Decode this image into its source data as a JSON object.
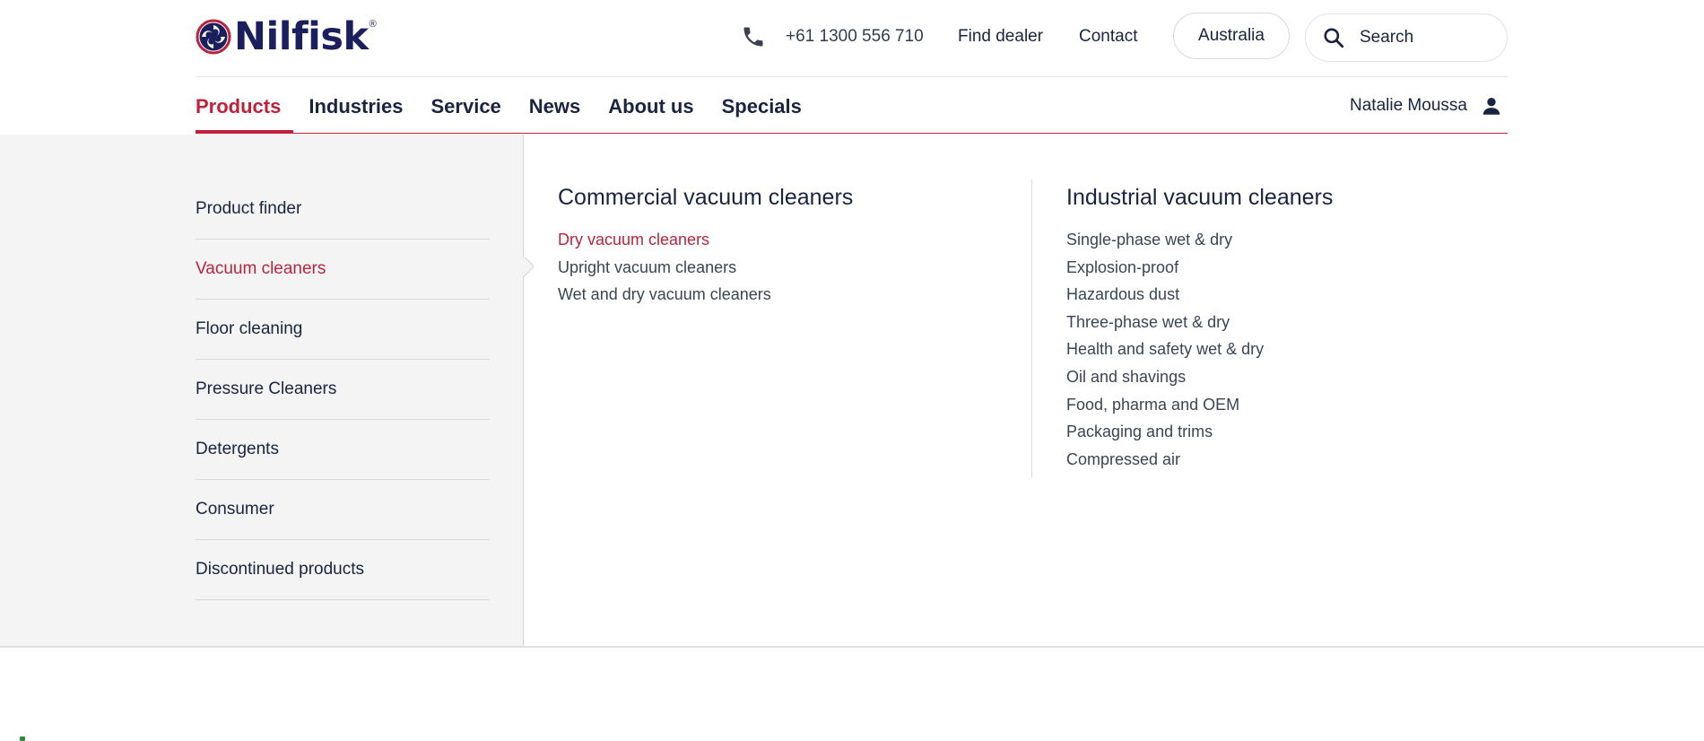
{
  "header": {
    "brand": "Nilfisk",
    "brand_mark": "®",
    "phone": "+61 1300 556 710",
    "find_dealer": "Find dealer",
    "contact": "Contact",
    "country": "Australia",
    "search_placeholder": "Search"
  },
  "nav": {
    "items": [
      {
        "label": "Products",
        "active": true
      },
      {
        "label": "Industries"
      },
      {
        "label": "Service"
      },
      {
        "label": "News"
      },
      {
        "label": "About us"
      },
      {
        "label": "Specials"
      }
    ],
    "user_name": "Natalie Moussa"
  },
  "mega": {
    "categories": [
      {
        "label": "Product finder"
      },
      {
        "label": "Vacuum cleaners",
        "active": true
      },
      {
        "label": "Floor cleaning"
      },
      {
        "label": "Pressure Cleaners"
      },
      {
        "label": "Detergents"
      },
      {
        "label": "Consumer"
      },
      {
        "label": "Discontinued products"
      }
    ],
    "commercial": {
      "title": "Commercial vacuum cleaners",
      "links": [
        "Dry vacuum cleaners",
        "Upright vacuum cleaners",
        "Wet and dry vacuum cleaners"
      ]
    },
    "industrial": {
      "title": "Industrial vacuum cleaners",
      "links": [
        "Single-phase wet & dry",
        "Explosion-proof",
        "Hazardous dust",
        "Three-phase wet & dry",
        "Health and safety wet & dry",
        "Oil and shavings",
        "Food, pharma and OEM",
        "Packaging and trims",
        "Compressed air"
      ]
    }
  },
  "colors": {
    "accent": "#c0203a",
    "navy": "#1a2440",
    "panel": "#f4f4f4"
  },
  "icons": {
    "phone": "phone-icon",
    "search": "search-icon",
    "user": "user-icon",
    "logo": "nilfisk-logo-icon"
  }
}
